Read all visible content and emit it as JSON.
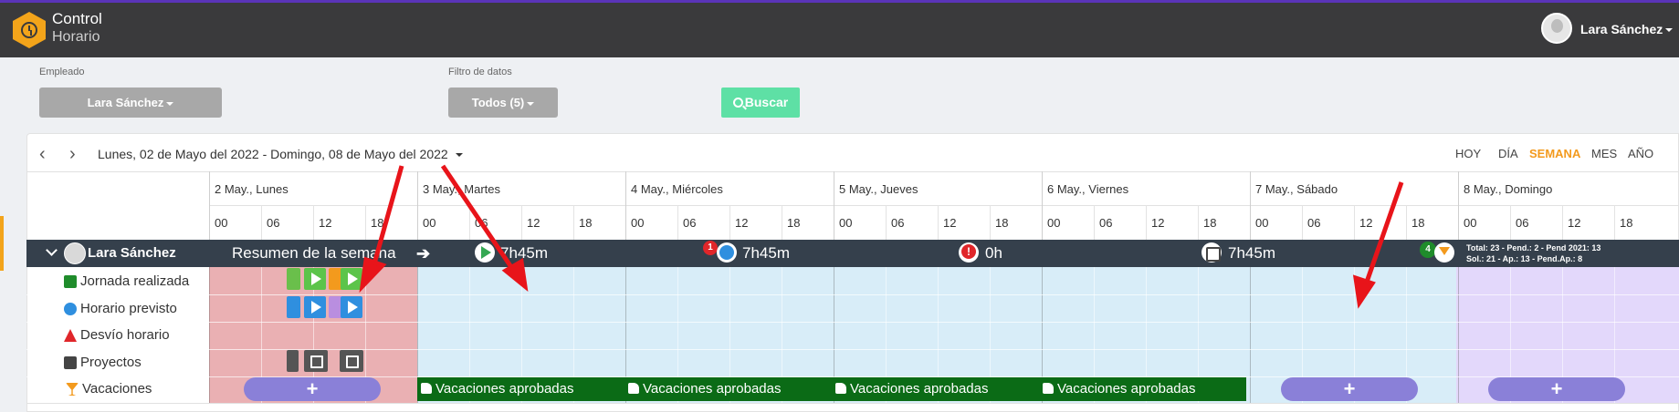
{
  "app": {
    "title_line1": "Control",
    "title_line2": "Horario"
  },
  "user_menu": {
    "name": "Lara Sánchez"
  },
  "filters": {
    "employee_label": "Empleado",
    "employee_value": "Lara Sánchez",
    "data_filter_label": "Filtro de datos",
    "data_filter_value": "Todos (5)",
    "search_label": "Buscar"
  },
  "calendar": {
    "period": "Lunes, 02 de Mayo del 2022 - Domingo, 08 de Mayo del 2022",
    "views": [
      "HOY",
      "DÍA",
      "SEMANA",
      "MES",
      "AÑO"
    ],
    "active_view": "SEMANA",
    "days": [
      "2 May., Lunes",
      "3 May., Martes",
      "4 May., Miércoles",
      "5 May., Jueves",
      "6 May., Viernes",
      "7 May., Sábado",
      "8 May., Domingo"
    ],
    "hours": [
      "00",
      "06",
      "12",
      "18"
    ]
  },
  "summary": {
    "user": "Lara Sánchez",
    "label": "Resumen de la semana",
    "worked": "7h45m",
    "planned": "7h45m",
    "planned_badge": "1",
    "deviation": "0h",
    "projects": "7h45m",
    "vacation_badge": "4",
    "totals_line1": "Total: 23 - Pend.: 2 - Pend 2021: 13",
    "totals_line2": "Sol.: 21 - Ap.: 13 - Pend.Ap.: 8"
  },
  "rows": [
    {
      "label": "Jornada realizada",
      "icon": "calendar-icon"
    },
    {
      "label": "Horario previsto",
      "icon": "clock-icon"
    },
    {
      "label": "Desvío horario",
      "icon": "warning-icon"
    },
    {
      "label": "Proyectos",
      "icon": "calendar-check-icon"
    },
    {
      "label": "Vacaciones",
      "icon": "cocktail-icon"
    }
  ],
  "vacations": {
    "add_label": "+",
    "approved_label": "Vacaciones aprobadas"
  },
  "colors": {
    "topbar": "#3a3a3c",
    "accent": "#f39a1d",
    "summary_row": "#35404c",
    "monday_bg": "#eab0b3",
    "weekday_bg": "#d8edf8",
    "weekend_bg": "#e3d8fb",
    "approved": "#0b6b16",
    "search_button": "#5ee0a5"
  }
}
